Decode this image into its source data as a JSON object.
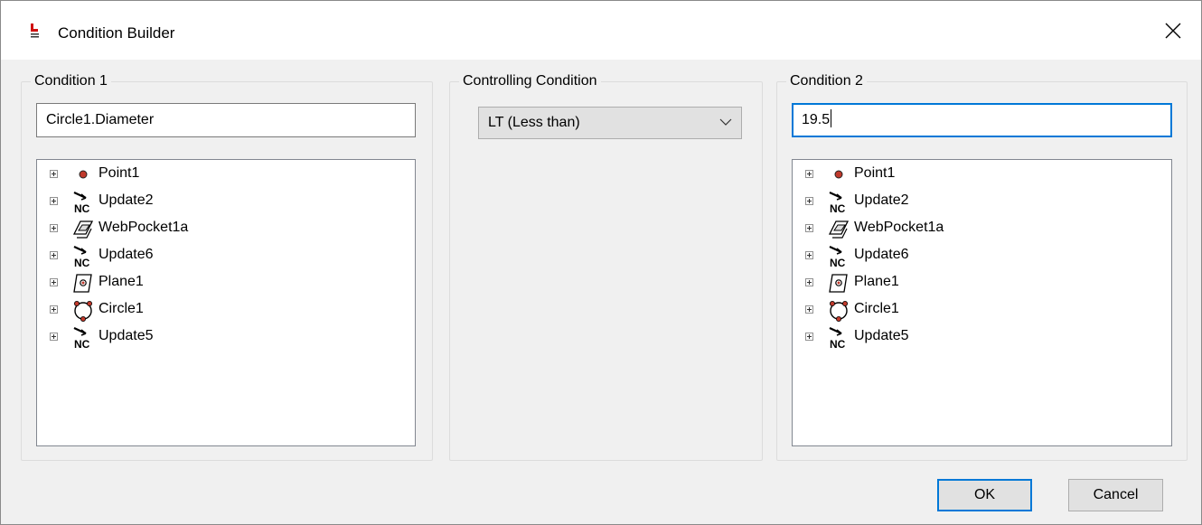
{
  "window": {
    "title": "Condition Builder"
  },
  "condition1": {
    "label": "Condition 1",
    "value": "Circle1.Diameter",
    "tree": [
      {
        "label": "Point1",
        "icon": "point-icon"
      },
      {
        "label": "Update2",
        "icon": "nc-update-icon"
      },
      {
        "label": "WebPocket1a",
        "icon": "pocket-icon"
      },
      {
        "label": "Update6",
        "icon": "nc-update-icon"
      },
      {
        "label": "Plane1",
        "icon": "plane-icon"
      },
      {
        "label": "Circle1",
        "icon": "circle-icon"
      },
      {
        "label": "Update5",
        "icon": "nc-update-icon"
      }
    ]
  },
  "controlling": {
    "label": "Controlling Condition",
    "selected": "LT (Less than)"
  },
  "condition2": {
    "label": "Condition 2",
    "value": "19.5",
    "tree": [
      {
        "label": "Point1",
        "icon": "point-icon"
      },
      {
        "label": "Update2",
        "icon": "nc-update-icon"
      },
      {
        "label": "WebPocket1a",
        "icon": "pocket-icon"
      },
      {
        "label": "Update6",
        "icon": "nc-update-icon"
      },
      {
        "label": "Plane1",
        "icon": "plane-icon"
      },
      {
        "label": "Circle1",
        "icon": "circle-icon"
      },
      {
        "label": "Update5",
        "icon": "nc-update-icon"
      }
    ]
  },
  "buttons": {
    "ok": "OK",
    "cancel": "Cancel"
  },
  "colors": {
    "accent": "#0078d7",
    "point": "#c0392b"
  }
}
